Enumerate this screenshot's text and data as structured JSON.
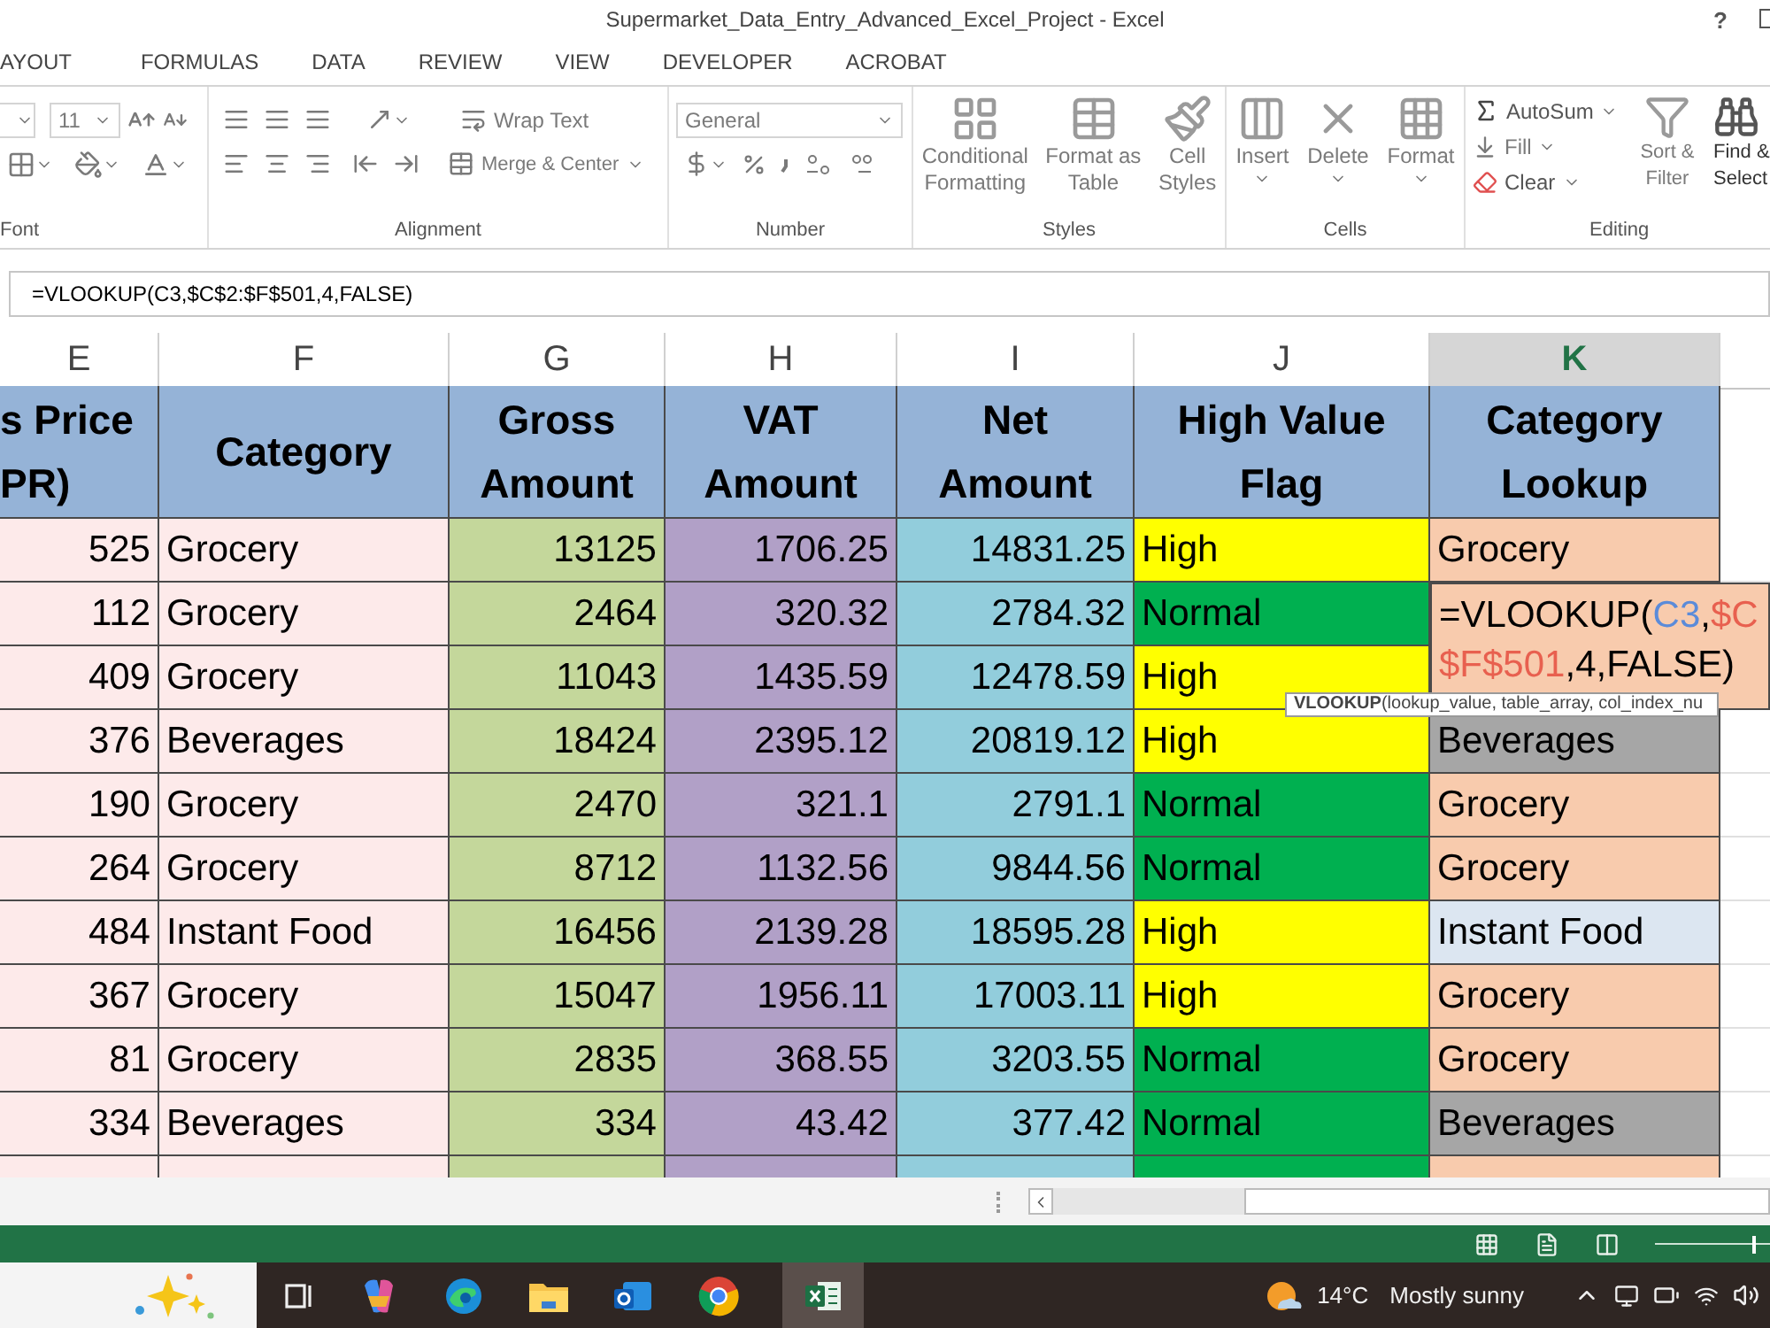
{
  "window": {
    "title": "Supermarket_Data_Entry_Advanced_Excel_Project - Excel",
    "help": "?"
  },
  "ribbon_tabs": [
    {
      "label": "AYOUT",
      "selected": false
    },
    {
      "label": "FORMULAS",
      "selected": false
    },
    {
      "label": "DATA",
      "selected": false
    },
    {
      "label": "REVIEW",
      "selected": false
    },
    {
      "label": "VIEW",
      "selected": false
    },
    {
      "label": "DEVELOPER",
      "selected": false
    },
    {
      "label": "ACROBAT",
      "selected": false
    }
  ],
  "ribbon": {
    "font": {
      "size": "11",
      "label": "Font"
    },
    "alignment": {
      "wrap_text": "Wrap Text",
      "merge": "Merge & Center",
      "label": "Alignment"
    },
    "number": {
      "format": "General",
      "label": "Number"
    },
    "styles": {
      "label": "Styles",
      "buttons": [
        {
          "lines": [
            "Conditional",
            "Formatting"
          ]
        },
        {
          "lines": [
            "Format as",
            "Table"
          ]
        },
        {
          "lines": [
            "Cell",
            "Styles"
          ]
        }
      ]
    },
    "cells": {
      "label": "Cells",
      "buttons": [
        {
          "label": "Insert"
        },
        {
          "label": "Delete"
        },
        {
          "label": "Format"
        }
      ]
    },
    "editing": {
      "label": "Editing",
      "autosum": "AutoSum",
      "fill": "Fill",
      "clear": "Clear",
      "sort": [
        "Sort &",
        "Filter"
      ],
      "find": [
        "Find &",
        "Select"
      ]
    }
  },
  "formula_bar": {
    "value": "=VLOOKUP(C3,$C$2:$F$501,4,FALSE)"
  },
  "columns": [
    {
      "letter": "E",
      "selected": false,
      "heading": [
        "s Price",
        "PR)"
      ]
    },
    {
      "letter": "F",
      "selected": false,
      "heading": [
        "Category"
      ]
    },
    {
      "letter": "G",
      "selected": false,
      "heading": [
        "Gross",
        "Amount"
      ]
    },
    {
      "letter": "H",
      "selected": false,
      "heading": [
        "VAT",
        "Amount"
      ]
    },
    {
      "letter": "I",
      "selected": false,
      "heading": [
        "Net",
        "Amount"
      ]
    },
    {
      "letter": "J",
      "selected": false,
      "heading": [
        "High Value",
        "Flag"
      ]
    },
    {
      "letter": "K",
      "selected": true,
      "heading": [
        "Category",
        "Lookup"
      ]
    }
  ],
  "rows": [
    {
      "e": "525",
      "f": "Grocery",
      "g": "13125",
      "h": "1706.25",
      "i": "14831.25",
      "flag": {
        "text": "High",
        "color": "#ffff00"
      },
      "lookup": {
        "text": "Grocery",
        "color": "#f8cbad"
      }
    },
    {
      "e": "112",
      "f": "Grocery",
      "g": "2464",
      "h": "320.32",
      "i": "2784.32",
      "flag": {
        "text": "Normal",
        "color": "#00b050"
      }
    },
    {
      "e": "409",
      "f": "Grocery",
      "g": "11043",
      "h": "1435.59",
      "i": "12478.59",
      "flag": {
        "text": "High",
        "color": "#ffff00"
      }
    },
    {
      "e": "376",
      "f": "Beverages",
      "g": "18424",
      "h": "2395.12",
      "i": "20819.12",
      "flag": {
        "text": "High",
        "color": "#ffff00"
      },
      "lookup": {
        "text": "Beverages",
        "color": "#a6a6a6"
      }
    },
    {
      "e": "190",
      "f": "Grocery",
      "g": "2470",
      "h": "321.1",
      "i": "2791.1",
      "flag": {
        "text": "Normal",
        "color": "#00b050"
      },
      "lookup": {
        "text": "Grocery",
        "color": "#f8cbad"
      }
    },
    {
      "e": "264",
      "f": "Grocery",
      "g": "8712",
      "h": "1132.56",
      "i": "9844.56",
      "flag": {
        "text": "Normal",
        "color": "#00b050"
      },
      "lookup": {
        "text": "Grocery",
        "color": "#f8cbad"
      }
    },
    {
      "e": "484",
      "f": "Instant Food",
      "g": "16456",
      "h": "2139.28",
      "i": "18595.28",
      "flag": {
        "text": "High",
        "color": "#ffff00"
      },
      "lookup": {
        "text": "Instant Food",
        "color": "#dce6f1"
      }
    },
    {
      "e": "367",
      "f": "Grocery",
      "g": "15047",
      "h": "1956.11",
      "i": "17003.11",
      "flag": {
        "text": "High",
        "color": "#ffff00"
      },
      "lookup": {
        "text": "Grocery",
        "color": "#f8cbad"
      }
    },
    {
      "e": "81",
      "f": "Grocery",
      "g": "2835",
      "h": "368.55",
      "i": "3203.55",
      "flag": {
        "text": "Normal",
        "color": "#00b050"
      },
      "lookup": {
        "text": "Grocery",
        "color": "#f8cbad"
      }
    },
    {
      "e": "334",
      "f": "Beverages",
      "g": "334",
      "h": "43.42",
      "i": "377.42",
      "flag": {
        "text": "Normal",
        "color": "#00b050"
      },
      "lookup": {
        "text": "Beverages",
        "color": "#a6a6a6"
      }
    },
    {
      "flag": {
        "color": "#00b050"
      },
      "lookup": {
        "color": "#f8cbad"
      }
    }
  ],
  "cell_editor": {
    "lines": [
      [
        {
          "text": "=VLOOKUP(",
          "color": "#000000"
        },
        {
          "text": "C3",
          "color": "#5b8bd9"
        },
        {
          "text": ",",
          "color": "#000000"
        },
        {
          "text": "$C",
          "color": "#e8604f"
        }
      ],
      [
        {
          "text": "$F$501",
          "color": "#e8604f"
        },
        {
          "text": ",4,FALSE)",
          "color": "#000000"
        }
      ]
    ]
  },
  "tooltip": "**VLOOKUP**(lookup_value, table_array, col_index_nu",
  "status_bar": {
    "zoom": {
      "level": 0.88
    }
  },
  "taskbar": {
    "temperature": "14°C",
    "weather": "Mostly sunny"
  }
}
